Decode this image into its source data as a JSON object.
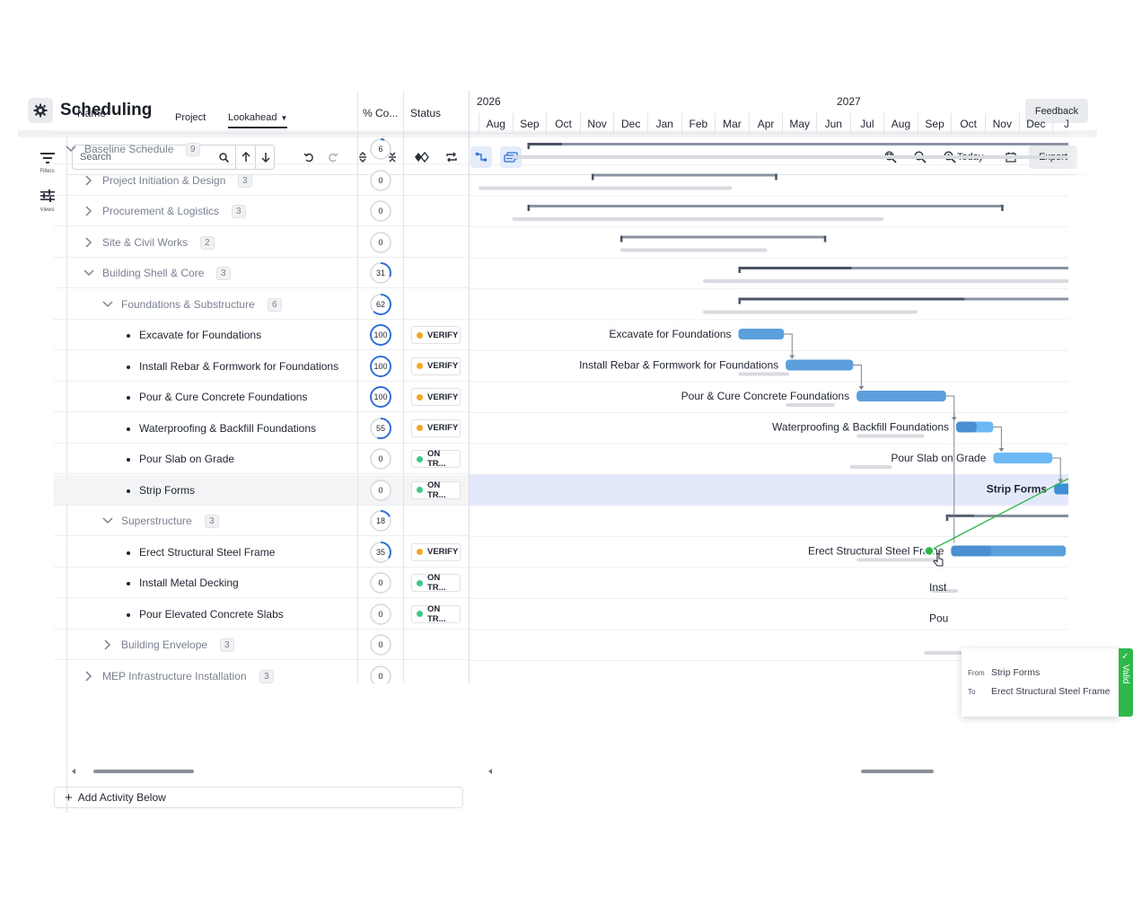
{
  "header": {
    "title": "Scheduling",
    "tabs": [
      {
        "label": "Project"
      },
      {
        "label": "Lookahead"
      }
    ],
    "feedback_label": "Feedback"
  },
  "rail": {
    "filters_label": "Filters",
    "views_label": "Views"
  },
  "toolbar": {
    "search_placeholder": "Search",
    "today_label": "Today",
    "export_label": "Export",
    "icons": [
      "search-icon",
      "arrow-up-icon",
      "arrow-down-icon",
      "undo-icon",
      "redo-icon",
      "expand-all-icon",
      "collapse-all-icon",
      "milestone-icon",
      "swap-icon",
      "link-icon",
      "layers-icon",
      "zoom-fit-icon",
      "zoom-out-icon",
      "zoom-in-icon",
      "calendar-icon"
    ]
  },
  "grid": {
    "columns": {
      "name": "Name",
      "complete": "% Co...",
      "status": "Status"
    },
    "rows": [
      {
        "name": "Baseline Schedule",
        "level": 0,
        "type": "group",
        "expanded": true,
        "count": "9",
        "pct": "6",
        "pct_fill": 0.06,
        "status": ""
      },
      {
        "name": "Project Initiation & Design",
        "level": 1,
        "type": "group",
        "expanded": false,
        "count": "3",
        "pct": "0",
        "pct_fill": 0,
        "status": ""
      },
      {
        "name": "Procurement & Logistics",
        "level": 1,
        "type": "group",
        "expanded": false,
        "count": "3",
        "pct": "0",
        "pct_fill": 0,
        "status": ""
      },
      {
        "name": "Site & Civil Works",
        "level": 1,
        "type": "group",
        "expanded": false,
        "count": "2",
        "pct": "0",
        "pct_fill": 0,
        "status": ""
      },
      {
        "name": "Building Shell & Core",
        "level": 1,
        "type": "group",
        "expanded": true,
        "count": "3",
        "pct": "31",
        "pct_fill": 0.31,
        "status": ""
      },
      {
        "name": "Foundations & Substructure",
        "level": 2,
        "type": "group",
        "expanded": true,
        "count": "6",
        "pct": "62",
        "pct_fill": 0.62,
        "status": ""
      },
      {
        "name": "Excavate for Foundations",
        "level": 3,
        "type": "task",
        "pct": "100",
        "pct_fill": 1.0,
        "status": "VERIFY",
        "status_color": "#f5a623"
      },
      {
        "name": "Install Rebar & Formwork for Foundations",
        "level": 3,
        "type": "task",
        "pct": "100",
        "pct_fill": 1.0,
        "status": "VERIFY",
        "status_color": "#f5a623"
      },
      {
        "name": "Pour & Cure Concrete Foundations",
        "level": 3,
        "type": "task",
        "pct": "100",
        "pct_fill": 1.0,
        "status": "VERIFY",
        "status_color": "#f5a623"
      },
      {
        "name": "Waterproofing & Backfill Foundations",
        "level": 3,
        "type": "task",
        "pct": "55",
        "pct_fill": 0.55,
        "status": "VERIFY",
        "status_color": "#f5a623"
      },
      {
        "name": "Pour Slab on Grade",
        "level": 3,
        "type": "task",
        "pct": "0",
        "pct_fill": 0,
        "status": "ON TR...",
        "status_color": "#3cc98a"
      },
      {
        "name": "Strip Forms",
        "level": 3,
        "type": "task",
        "pct": "0",
        "pct_fill": 0,
        "status": "ON TR...",
        "status_color": "#3cc98a",
        "selected": true
      },
      {
        "name": "Superstructure",
        "level": 2,
        "type": "group",
        "expanded": true,
        "count": "3",
        "pct": "18",
        "pct_fill": 0.18,
        "status": ""
      },
      {
        "name": "Erect Structural Steel Frame",
        "level": 3,
        "type": "task",
        "pct": "35",
        "pct_fill": 0.35,
        "status": "VERIFY",
        "status_color": "#f5a623"
      },
      {
        "name": "Install Metal Decking",
        "level": 3,
        "type": "task",
        "pct": "0",
        "pct_fill": 0,
        "status": "ON TR...",
        "status_color": "#3cc98a"
      },
      {
        "name": "Pour Elevated Concrete Slabs",
        "level": 3,
        "type": "task",
        "pct": "0",
        "pct_fill": 0,
        "status": "ON TR...",
        "status_color": "#3cc98a"
      },
      {
        "name": "Building Envelope",
        "level": 2,
        "type": "group",
        "expanded": false,
        "count": "3",
        "pct": "0",
        "pct_fill": 0,
        "status": ""
      },
      {
        "name": "MEP Infrastructure Installation",
        "level": 1,
        "type": "group",
        "expanded": false,
        "count": "3",
        "pct": "0",
        "pct_fill": 0,
        "status": ""
      }
    ],
    "add_activity_label": "Add Activity Below"
  },
  "gantt": {
    "years": [
      "2026",
      "2027"
    ],
    "months": [
      "Aug",
      "Sep",
      "Oct",
      "Nov",
      "Dec",
      "Jan",
      "Feb",
      "Mar",
      "Apr",
      "May",
      "Jun",
      "Jul",
      "Aug",
      "Sep",
      "Oct",
      "Nov",
      "Dec",
      "Ja"
    ],
    "bar_labels": [
      {
        "row": 6,
        "text": "Excavate for Foundations"
      },
      {
        "row": 7,
        "text": "Install Rebar & Formwork for Foundations"
      },
      {
        "row": 8,
        "text": "Pour & Cure Concrete Foundations"
      },
      {
        "row": 9,
        "text": "Waterproofing & Backfill Foundations"
      },
      {
        "row": 10,
        "text": "Pour Slab on Grade"
      },
      {
        "row": 11,
        "text": "Strip Forms"
      },
      {
        "row": 13,
        "text": "Erect Structural Steel Frame"
      },
      {
        "row": 14,
        "text": "Inst"
      },
      {
        "row": 15,
        "text": "Pou"
      }
    ],
    "bars": [
      {
        "row": 0,
        "kind": "summary",
        "start": 1.45,
        "end": 18.5,
        "progress": 0.06,
        "bstart": 1.0,
        "bend": 18.5
      },
      {
        "row": 1,
        "kind": "summary",
        "start": 3.35,
        "end": 8.85,
        "progress": 0,
        "bstart": 0,
        "bend": 7.5
      },
      {
        "row": 2,
        "kind": "summary",
        "start": 1.45,
        "end": 15.55,
        "progress": 0,
        "bstart": 1.0,
        "bend": 12.0
      },
      {
        "row": 3,
        "kind": "summary",
        "start": 4.2,
        "end": 10.3,
        "progress": 0,
        "bstart": 4.2,
        "bend": 8.55
      },
      {
        "row": 4,
        "kind": "summary",
        "start": 7.7,
        "end": 18.5,
        "progress": 0.31,
        "bstart": 6.65,
        "bend": 18.5
      },
      {
        "row": 5,
        "kind": "summary",
        "start": 7.7,
        "end": 18.5,
        "progress": 0.62,
        "bstart": 6.65,
        "bend": 13.0
      },
      {
        "row": 6,
        "kind": "task",
        "start": 7.7,
        "end": 9.05,
        "progress": 1.0,
        "color": "#5b9fdc",
        "bstart": 0,
        "bend": 0
      },
      {
        "row": 7,
        "kind": "task",
        "start": 9.1,
        "end": 11.1,
        "progress": 1.0,
        "color": "#5b9fdc",
        "bstart": 7.7,
        "bend": 9.2
      },
      {
        "row": 8,
        "kind": "task",
        "start": 11.2,
        "end": 13.85,
        "progress": 1.0,
        "color": "#5b9fdc",
        "bstart": 9.1,
        "bend": 10.55
      },
      {
        "row": 9,
        "kind": "task",
        "start": 14.15,
        "end": 15.25,
        "progress": 0.55,
        "color": "#6cb8f5",
        "bstart": 11.2,
        "bend": 13.2
      },
      {
        "row": 10,
        "kind": "task",
        "start": 15.25,
        "end": 17.0,
        "progress": 0,
        "color": "#6cb8f5",
        "bstart": 11.0,
        "bend": 12.25
      },
      {
        "row": 11,
        "kind": "task",
        "start": 17.05,
        "end": 18.5,
        "progress": 0,
        "color": "#3f8fd6",
        "bstart": 0,
        "bend": 0
      },
      {
        "row": 12,
        "kind": "summary",
        "start": 13.85,
        "end": 18.5,
        "progress": 0.18,
        "bstart": 0,
        "bend": 0
      },
      {
        "row": 13,
        "kind": "task",
        "start": 14.0,
        "end": 17.4,
        "progress": 0.35,
        "color": "#5b9fdc",
        "bstart": 11.2,
        "bend": 13.65
      },
      {
        "row": 14,
        "kind": "task",
        "start": 18.5,
        "end": 18.5,
        "progress": 0,
        "color": "#5b9fdc",
        "bstart": 13.4,
        "bend": 14.2
      },
      {
        "row": 15,
        "kind": "task",
        "start": 18.5,
        "end": 18.5,
        "progress": 0,
        "color": "#5b9fdc",
        "bstart": 0,
        "bend": 0
      },
      {
        "row": 16,
        "kind": "summary",
        "start": 17.55,
        "end": 18.5,
        "progress": 0,
        "bstart": 13.2,
        "bend": 18.5
      },
      {
        "row": 17,
        "kind": "summary",
        "start": 15.15,
        "end": 18.5,
        "progress": 0,
        "bstart": 0,
        "bend": 0
      }
    ]
  },
  "tooltip": {
    "from_label": "From",
    "from_value": "Strip Forms",
    "to_label": "To",
    "to_value": "Erect Structural Steel Frame",
    "valid_label": "Valid"
  },
  "colors": {
    "accent": "#2f6fd6",
    "summary_bar": "#4a5363",
    "baseline": "#d8dbe0",
    "valid": "#2eb84a",
    "selected_row": "#e4e8fb"
  }
}
